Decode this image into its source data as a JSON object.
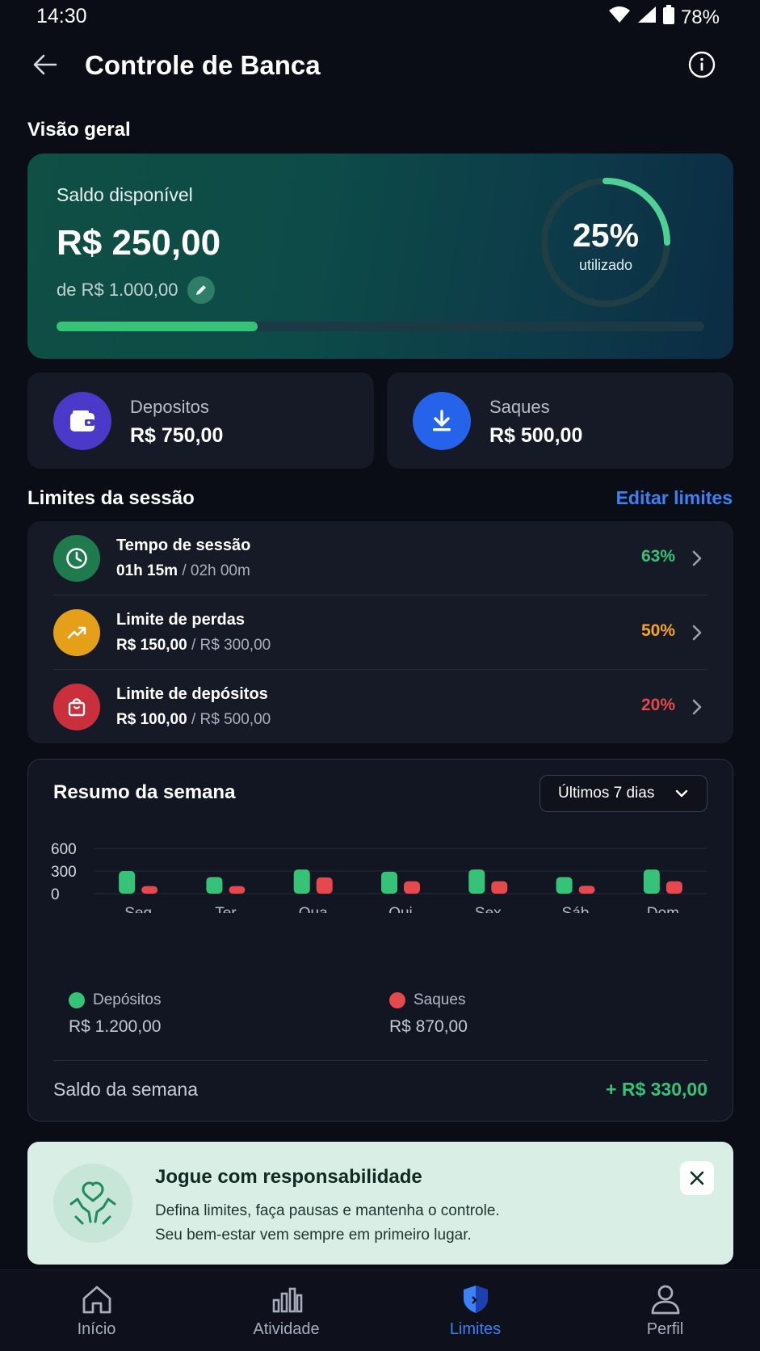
{
  "status": {
    "time": "14:30",
    "battery": "78%"
  },
  "header": {
    "title": "Controle de Banca"
  },
  "overview": {
    "section_title": "Visão geral",
    "balance_label": "Saldo disponível",
    "balance_amount": "R$ 250,00",
    "limit_text": "de R$ 1.000,00",
    "used_percent_text": "25%",
    "used_label": "utilizado",
    "used_fraction": 0.25,
    "bar_fraction": 0.31
  },
  "stats": {
    "deposits_label": "Depositos",
    "deposits_value": "R$ 750,00",
    "withdrawals_label": "Saques",
    "withdrawals_value": "R$ 500,00"
  },
  "limits": {
    "section_title": "Limites da sessão",
    "edit_link": "Editar limites",
    "items": [
      {
        "title": "Tempo de sessão",
        "current": "01h 15m",
        "total": " / 02h 00m",
        "percent": "63%",
        "color": "#36c277"
      },
      {
        "title": "Limite de perdas",
        "current": "R$ 150,00",
        "total": " / R$ 300,00",
        "percent": "50%",
        "color": "#f5a623"
      },
      {
        "title": "Limite de depósitos",
        "current": "R$ 100,00",
        "total": " / R$ 500,00",
        "percent": "20%",
        "color": "#e5484d"
      }
    ]
  },
  "week": {
    "title": "Resumo da semana",
    "range": "Últimos 7 dias",
    "deposits_legend": "Depósitos",
    "deposits_total": "R$ 1.200,00",
    "withdrawals_legend": "Saques",
    "withdrawals_total": "R$ 870,00",
    "balance_label": "Saldo da semana",
    "balance_value": "+ R$ 330,00"
  },
  "chart_data": {
    "type": "bar",
    "categories": [
      "Seg",
      "Ter",
      "Qua",
      "Qui",
      "Sex",
      "Sáb",
      "Dom"
    ],
    "series": [
      {
        "name": "Depósitos",
        "values": [
          300,
          220,
          320,
          290,
          320,
          220,
          320
        ],
        "color": "#36c277"
      },
      {
        "name": "Saques",
        "values": [
          100,
          100,
          215,
          165,
          165,
          105,
          165
        ],
        "color": "#e5484d"
      }
    ],
    "yticks": [
      "600",
      "300",
      "0"
    ],
    "ylim": [
      0,
      600
    ],
    "grid": true,
    "legend": "bottom"
  },
  "banner": {
    "title": "Jogue com responsabilidade",
    "line1": "Defina limites, faça pausas e mantenha o controle.",
    "line2": "Seu bem-estar vem sempre em primeiro lugar."
  },
  "nav": {
    "items": [
      {
        "label": "Início",
        "icon": "home-icon"
      },
      {
        "label": "Atividade",
        "icon": "bar-chart-icon"
      },
      {
        "label": "Limites",
        "icon": "shield-icon"
      },
      {
        "label": "Perfil",
        "icon": "user-icon"
      }
    ],
    "active_index": 2,
    "accent": "#3b82f6"
  }
}
